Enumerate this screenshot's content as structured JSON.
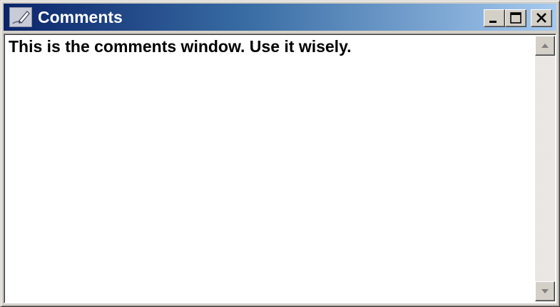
{
  "window": {
    "title": "Comments"
  },
  "content": {
    "text": "This is the comments window. Use it wisely."
  },
  "icons": {
    "app": "pen-icon",
    "minimize": "minimize-icon",
    "maximize": "maximize-icon",
    "close": "close-icon",
    "scroll_up": "scroll-up-arrow-icon",
    "scroll_down": "scroll-down-arrow-icon"
  },
  "colors": {
    "titlebar_start": "#0a246a",
    "titlebar_end": "#a6caf0",
    "face": "#d4d0c8",
    "content_bg": "#ffffff"
  }
}
